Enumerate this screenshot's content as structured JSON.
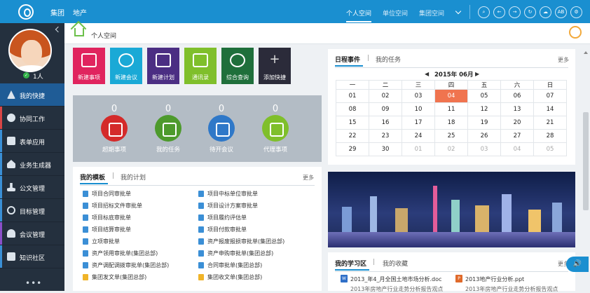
{
  "topnav": {
    "left": [
      "集团",
      "地产"
    ],
    "right": [
      "个人空间",
      "单位空间",
      "集团空间"
    ],
    "icons": [
      "search-icon",
      "back-icon",
      "forward-icon",
      "refresh-icon",
      "cloud-icon",
      "ab-icon",
      "settings-icon"
    ],
    "ab_text": "AB"
  },
  "user": {
    "count": "1人"
  },
  "sidebar": {
    "items": [
      {
        "label": "我的快捷",
        "icon": "triangle-icon",
        "color": "#3a8fd6"
      },
      {
        "label": "协同工作",
        "icon": "share-icon",
        "color": "#d94646"
      },
      {
        "label": "表单应用",
        "icon": "form-icon",
        "color": "#3a8fd6"
      },
      {
        "label": "业务生成器",
        "icon": "home-icon",
        "color": "#3a8fd6"
      },
      {
        "label": "公文管理",
        "icon": "stamp-icon",
        "color": "#3a8fd6"
      },
      {
        "label": "目标管理",
        "icon": "target-icon",
        "color": "#3a8fd6"
      },
      {
        "label": "会议管理",
        "icon": "meeting-icon",
        "color": "#8b4fc9"
      },
      {
        "label": "知识社区",
        "icon": "book-icon",
        "color": "#3a8fd6"
      }
    ],
    "more": "•••"
  },
  "breadcrumb": {
    "title": "个人空间"
  },
  "shortcuts": [
    {
      "label": "新建事项",
      "color": "#e0245e"
    },
    {
      "label": "新建会议",
      "color": "#1aa9d6"
    },
    {
      "label": "新建计划",
      "color": "#4b2e83"
    },
    {
      "label": "通讯录",
      "color": "#7fbf2b"
    },
    {
      "label": "综合查询",
      "color": "#1f6f3b"
    },
    {
      "label": "添加快捷",
      "color": "#2b2b3a"
    }
  ],
  "counters": [
    {
      "value": "0",
      "label": "超期事项",
      "color": "#d42a2a"
    },
    {
      "value": "0",
      "label": "我的任务",
      "color": "#4d9a2c"
    },
    {
      "value": "0",
      "label": "待开会议",
      "color": "#2f78c8"
    },
    {
      "value": "0",
      "label": "代理事项",
      "color": "#7fbf2b"
    }
  ],
  "templates": {
    "tab_active": "我的模板",
    "tab_other": "我的计划",
    "more": "更多",
    "left": [
      "项目合同审批单",
      "项目招标文件审批单",
      "项目标底审批单",
      "项目结算审批单",
      "立项审批单",
      "资产领用审批单(集团总部)",
      "资产调配调拨审批单(集团总部)",
      "集团发文单(集团总部)"
    ],
    "right": [
      "项目中标单位审批单",
      "项目设计方案审批单",
      "项目履约评估单",
      "项目付款审批单",
      "资产报废报损审批单(集团总部)",
      "资产申购审批单(集团总部)",
      "合同审批单(集团总部)",
      "集团收文单(集团总部)"
    ]
  },
  "calendar": {
    "tab_active": "日程事件",
    "tab_other": "我的任务",
    "more": "更多",
    "month": "2015年 06月",
    "prev": "◀",
    "next": "▶",
    "weekdays": [
      "一",
      "二",
      "三",
      "四",
      "五",
      "六",
      "日"
    ],
    "rows": [
      [
        "01",
        "02",
        "03",
        "04",
        "05",
        "06",
        "07"
      ],
      [
        "08",
        "09",
        "10",
        "11",
        "12",
        "13",
        "14"
      ],
      [
        "15",
        "16",
        "17",
        "18",
        "19",
        "20",
        "21"
      ],
      [
        "22",
        "23",
        "24",
        "25",
        "26",
        "27",
        "28"
      ],
      [
        "29",
        "30",
        "01",
        "02",
        "03",
        "04",
        "05"
      ]
    ],
    "today": "04"
  },
  "learning": {
    "tab_active": "我的学习区",
    "tab_other": "我的收藏",
    "more": "更多",
    "files": [
      {
        "name": "2013_年4_月全国土地市场分析.doc",
        "type": "W",
        "color": "#2f6fc8"
      },
      {
        "name": "2013地产行业分析.ppt",
        "type": "P",
        "color": "#e06a2b"
      }
    ],
    "partial": [
      "2013年房地产行业走势分析报告观点",
      "2013年房地产行业走势分析报告观点"
    ]
  }
}
